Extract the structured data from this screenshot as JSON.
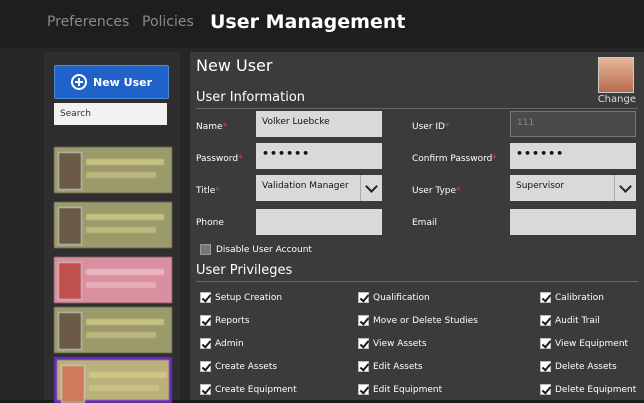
{
  "nav": {
    "preferences": "Preferences",
    "policies": "Policies",
    "user_management": "User Management"
  },
  "sidebar": {
    "new_user_label": "New User",
    "search_placeholder": "Search"
  },
  "form": {
    "title": "New User",
    "change_label": "Change",
    "user_info_heading": "User Information",
    "name_label": "Name",
    "name_value": "Volker Luebcke",
    "user_id_label": "User ID",
    "user_id_value": "111",
    "password_label": "Password",
    "password_value": "••••••",
    "confirm_password_label": "Confirm Password",
    "confirm_password_value": "••••••",
    "title_label": "Title",
    "title_value": "Validation Manager",
    "user_type_label": "User Type",
    "user_type_value": "Supervisor",
    "phone_label": "Phone",
    "email_label": "Email",
    "disable_label": "Disable User Account",
    "privileges_heading": "User Privileges"
  },
  "privileges": {
    "col1": [
      "Setup Creation",
      "Reports",
      "Admin",
      "Create Assets",
      "Create Equipment"
    ],
    "col2": [
      "Qualification",
      "Move or Delete Studies",
      "View Assets",
      "Edit Assets",
      "Edit Equipment"
    ],
    "col3": [
      "Calibration",
      "Audit Trail",
      "View Equipment",
      "Delete Assets",
      "Delete Equipment"
    ]
  },
  "colors": {
    "accent": "#1f63c8",
    "selected_border": "#6a2fb8",
    "required": "#e04040"
  }
}
